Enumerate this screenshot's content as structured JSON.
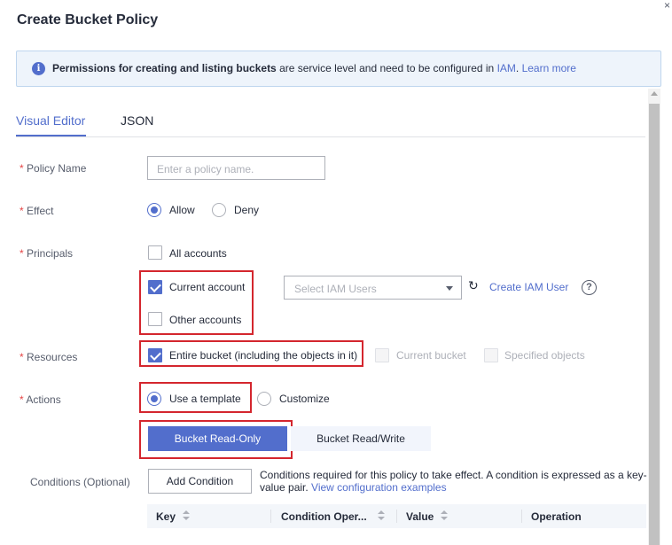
{
  "dialog": {
    "title": "Create Bucket Policy",
    "close_glyph": "×"
  },
  "info": {
    "icon": "info-icon",
    "bold": "Permissions for creating and listing buckets",
    "text": " are service level and need to be configured in ",
    "iam_link": "IAM",
    "sep": ". ",
    "learn_more": "Learn more"
  },
  "tabs": [
    {
      "label": "Visual Editor",
      "active": true
    },
    {
      "label": "JSON",
      "active": false
    }
  ],
  "form": {
    "policy_name": {
      "label": "Policy Name",
      "placeholder": "Enter a policy name.",
      "value": ""
    },
    "effect": {
      "label": "Effect",
      "options": [
        {
          "label": "Allow",
          "selected": true
        },
        {
          "label": "Deny",
          "selected": false
        }
      ]
    },
    "principals": {
      "label": "Principals",
      "all_accounts": {
        "label": "All accounts",
        "checked": false
      },
      "current_account": {
        "label": "Current account",
        "checked": true
      },
      "other_accounts": {
        "label": "Other accounts",
        "checked": false
      },
      "iam_users_placeholder": "Select IAM Users",
      "create_iam_user": "Create IAM User",
      "help_glyph": "?",
      "refresh_glyph": "↻"
    },
    "resources": {
      "label": "Resources",
      "entire_bucket": {
        "label": "Entire bucket (including the objects in it)",
        "checked": true
      },
      "current_bucket": {
        "label": "Current bucket",
        "checked": false,
        "disabled": true
      },
      "specified_objects": {
        "label": "Specified objects",
        "checked": false,
        "disabled": true
      }
    },
    "actions": {
      "label": "Actions",
      "options": [
        {
          "label": "Use a template",
          "selected": true
        },
        {
          "label": "Customize",
          "selected": false
        }
      ],
      "templates": [
        {
          "label": "Bucket Read-Only",
          "selected": true
        },
        {
          "label": "Bucket Read/Write",
          "selected": false
        }
      ]
    },
    "conditions": {
      "label": "Conditions (Optional)",
      "add_button": "Add Condition",
      "description": "Conditions required for this policy to take effect. A condition is expressed as a key-value pair. ",
      "examples_link": "View configuration examples",
      "columns": [
        "Key",
        "Condition Oper...",
        "Value",
        "Operation"
      ]
    },
    "required_mark": "*"
  },
  "colors": {
    "accent": "#526ecc",
    "required": "#e54545",
    "highlight_box": "#d4262e"
  }
}
